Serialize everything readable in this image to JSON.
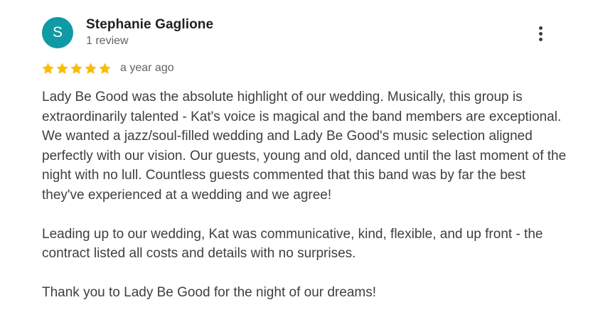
{
  "reviewer": {
    "initial": "S",
    "name": "Stephanie Gaglione",
    "review_count": "1 review",
    "avatar_color": "#0f9aa5"
  },
  "menu": {
    "icon": "more-vertical-icon"
  },
  "rating": {
    "stars": 5,
    "max_stars": 5,
    "star_color": "#fbbc04",
    "date": "a year ago"
  },
  "review": {
    "paragraphs": [
      "Lady Be Good was the absolute highlight of our wedding. Musically, this group is extraordinarily talented - Kat's voice is magical and the band members are exceptional. We wanted a jazz/soul-filled wedding and Lady Be Good's music selection aligned perfectly with our vision. Our guests, young and old, danced until the last moment of the night with no lull. Countless guests commented that this band was by far the best they've experienced at a wedding and we agree!",
      "Leading up to our wedding, Kat was communicative, kind, flexible, and up front - the contract listed all costs and details with no surprises.",
      "Thank you to Lady Be Good for the night of our dreams!"
    ]
  }
}
